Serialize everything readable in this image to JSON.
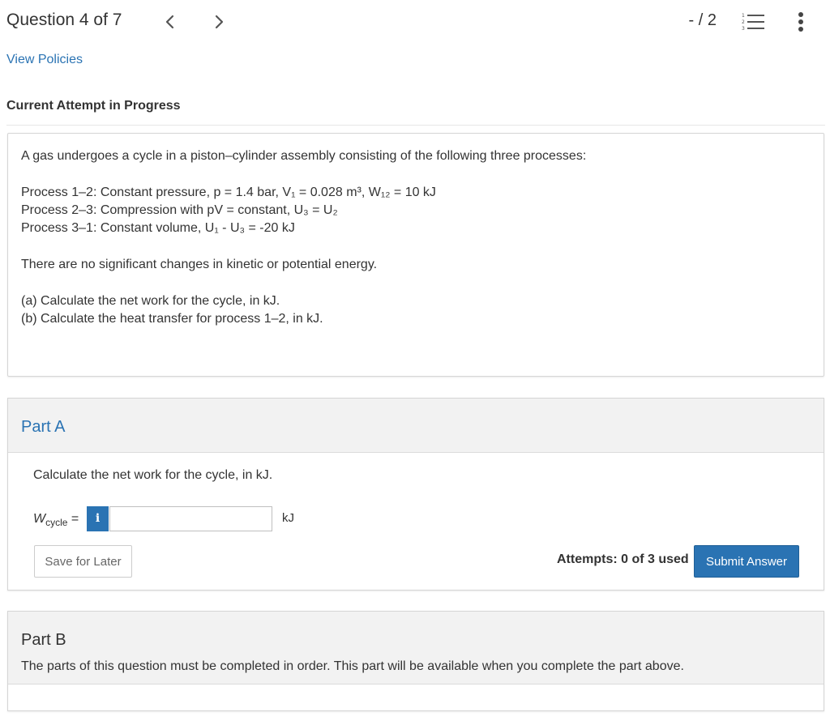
{
  "header": {
    "question_label": "Question 4 of 7",
    "score": "- / 2",
    "prev_icon": "chevron-left-icon",
    "next_icon": "chevron-right-icon",
    "list_icon": "numbered-list-icon",
    "more_icon": "vertical-ellipsis-icon"
  },
  "policies_link": "View Policies",
  "attempt_status": "Current Attempt in Progress",
  "question": {
    "intro": "A gas undergoes a cycle in a piston–cylinder assembly consisting of the following three processes:",
    "process_1_2": "Process 1–2: Constant pressure, p = 1.4 bar, V₁ = 0.028 m³, W₁₂ = 10 kJ",
    "process_2_3": "Process 2–3: Compression with pV = constant, U₃ = U₂",
    "process_3_1": "Process 3–1: Constant volume, U₁ - U₃ = -20 kJ",
    "energy_note": "There are no significant changes in kinetic or potential energy.",
    "part_a": "(a) Calculate the net work for the cycle, in kJ.",
    "part_b": "(b) Calculate the heat transfer for process 1–2, in kJ."
  },
  "part_a": {
    "title": "Part A",
    "prompt": "Calculate the net work for the cycle, in kJ.",
    "var_symbol": "W",
    "var_subscript": "cycle",
    "var_eq": " =",
    "info_label": "i",
    "input_value": "",
    "unit": "kJ",
    "save_label": "Save for Later",
    "attempts": "Attempts: 0 of 3 used",
    "submit_label": "Submit Answer"
  },
  "part_b": {
    "title": "Part B",
    "note": "The parts of this question must be completed in order. This part will be available when you complete the part above."
  },
  "colors": {
    "accent": "#2a73b3",
    "panel_bg": "#f2f2f2",
    "border": "#d5d5d5"
  }
}
